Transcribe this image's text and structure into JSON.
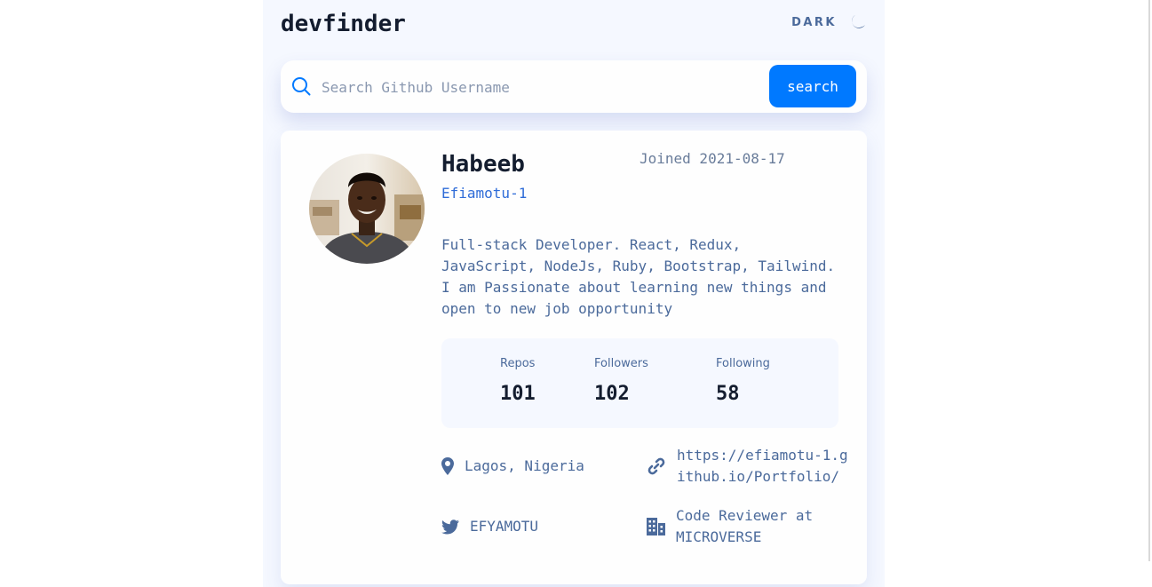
{
  "header": {
    "logo": "devfinder",
    "theme_label": "DARK",
    "theme_icon": "moon-icon"
  },
  "search": {
    "placeholder": "Search Github Username",
    "value": "",
    "button_label": "search",
    "icon": "search-icon"
  },
  "profile": {
    "name": "Habeeb",
    "username": "Efiamotu-1",
    "joined": "Joined 2021-08-17",
    "bio": "Full-stack Developer. React, Redux, JavaScript, NodeJs, Ruby, Bootstrap, Tailwind. I am Passionate about learning new things and open to new job opportunity",
    "stats": {
      "repos_label": "Repos",
      "repos_value": "101",
      "followers_label": "Followers",
      "followers_value": "102",
      "following_label": "Following",
      "following_value": "58"
    },
    "links": {
      "location": "Lagos, Nigeria",
      "website": "https://efiamotu-1.github.io/Portfolio/",
      "twitter": "EFYAMOTU",
      "company": "Code Reviewer at MICROVERSE"
    }
  },
  "colors": {
    "accent": "#0079ff",
    "page_bg": "#f5f8ff",
    "card_bg": "#fefefe",
    "text_muted": "#4b6a9b",
    "heading": "#141d2f"
  }
}
